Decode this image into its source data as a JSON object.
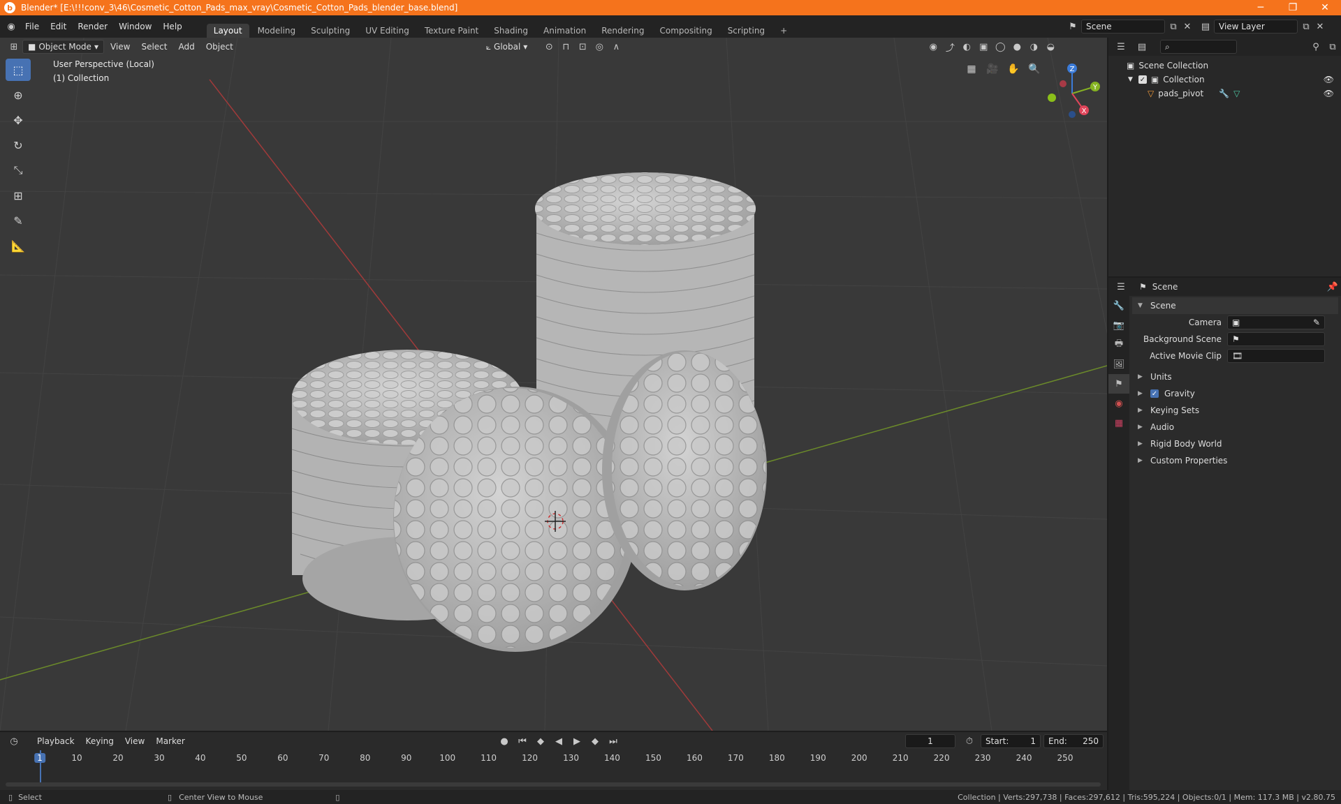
{
  "titlebar": {
    "title": "Blender* [E:\\!!!conv_3\\46\\Cosmetic_Cotton_Pads_max_vray\\Cosmetic_Cotton_Pads_blender_base.blend]",
    "min": "─",
    "max": "❐",
    "close": "✕"
  },
  "menu": [
    "File",
    "Edit",
    "Render",
    "Window",
    "Help"
  ],
  "workspaces": [
    "Layout",
    "Modeling",
    "Sculpting",
    "UV Editing",
    "Texture Paint",
    "Shading",
    "Animation",
    "Rendering",
    "Compositing",
    "Scripting"
  ],
  "add_tab": "+",
  "scene_field": "Scene",
  "view_layer_field": "View Layer",
  "viewport": {
    "mode": "Object Mode",
    "menus": [
      "View",
      "Select",
      "Add",
      "Object"
    ],
    "orientation": "Global",
    "info_line1": "User Perspective (Local)",
    "info_line2": "(1) Collection",
    "gizmo": {
      "z": "Z",
      "y": "Y",
      "x": "X"
    }
  },
  "outliner": {
    "scene_collection": "Scene Collection",
    "collection": "Collection",
    "object": "pads_pivot"
  },
  "properties": {
    "context": "Scene",
    "panel": "Scene",
    "camera_label": "Camera",
    "background_label": "Background Scene",
    "movie_clip_label": "Active Movie Clip",
    "sections": [
      "Units",
      "Gravity",
      "Keying Sets",
      "Audio",
      "Rigid Body World",
      "Custom Properties"
    ]
  },
  "timeline": {
    "menus": [
      "Playback",
      "Keying",
      "View",
      "Marker"
    ],
    "current_frame": "1",
    "start_label": "Start:",
    "start": "1",
    "end_label": "End:",
    "end": "250",
    "ticks": [
      "1",
      "10",
      "20",
      "30",
      "40",
      "50",
      "60",
      "70",
      "80",
      "90",
      "100",
      "110",
      "120",
      "130",
      "140",
      "150",
      "160",
      "170",
      "180",
      "190",
      "200",
      "210",
      "220",
      "230",
      "240",
      "250"
    ]
  },
  "status": {
    "left": "Select",
    "middle": "Center View to Mouse",
    "right": "Collection | Verts:297,738 | Faces:297,612 | Tris:595,224 | Objects:0/1 | Mem: 117.3 MB | v2.80.75"
  }
}
